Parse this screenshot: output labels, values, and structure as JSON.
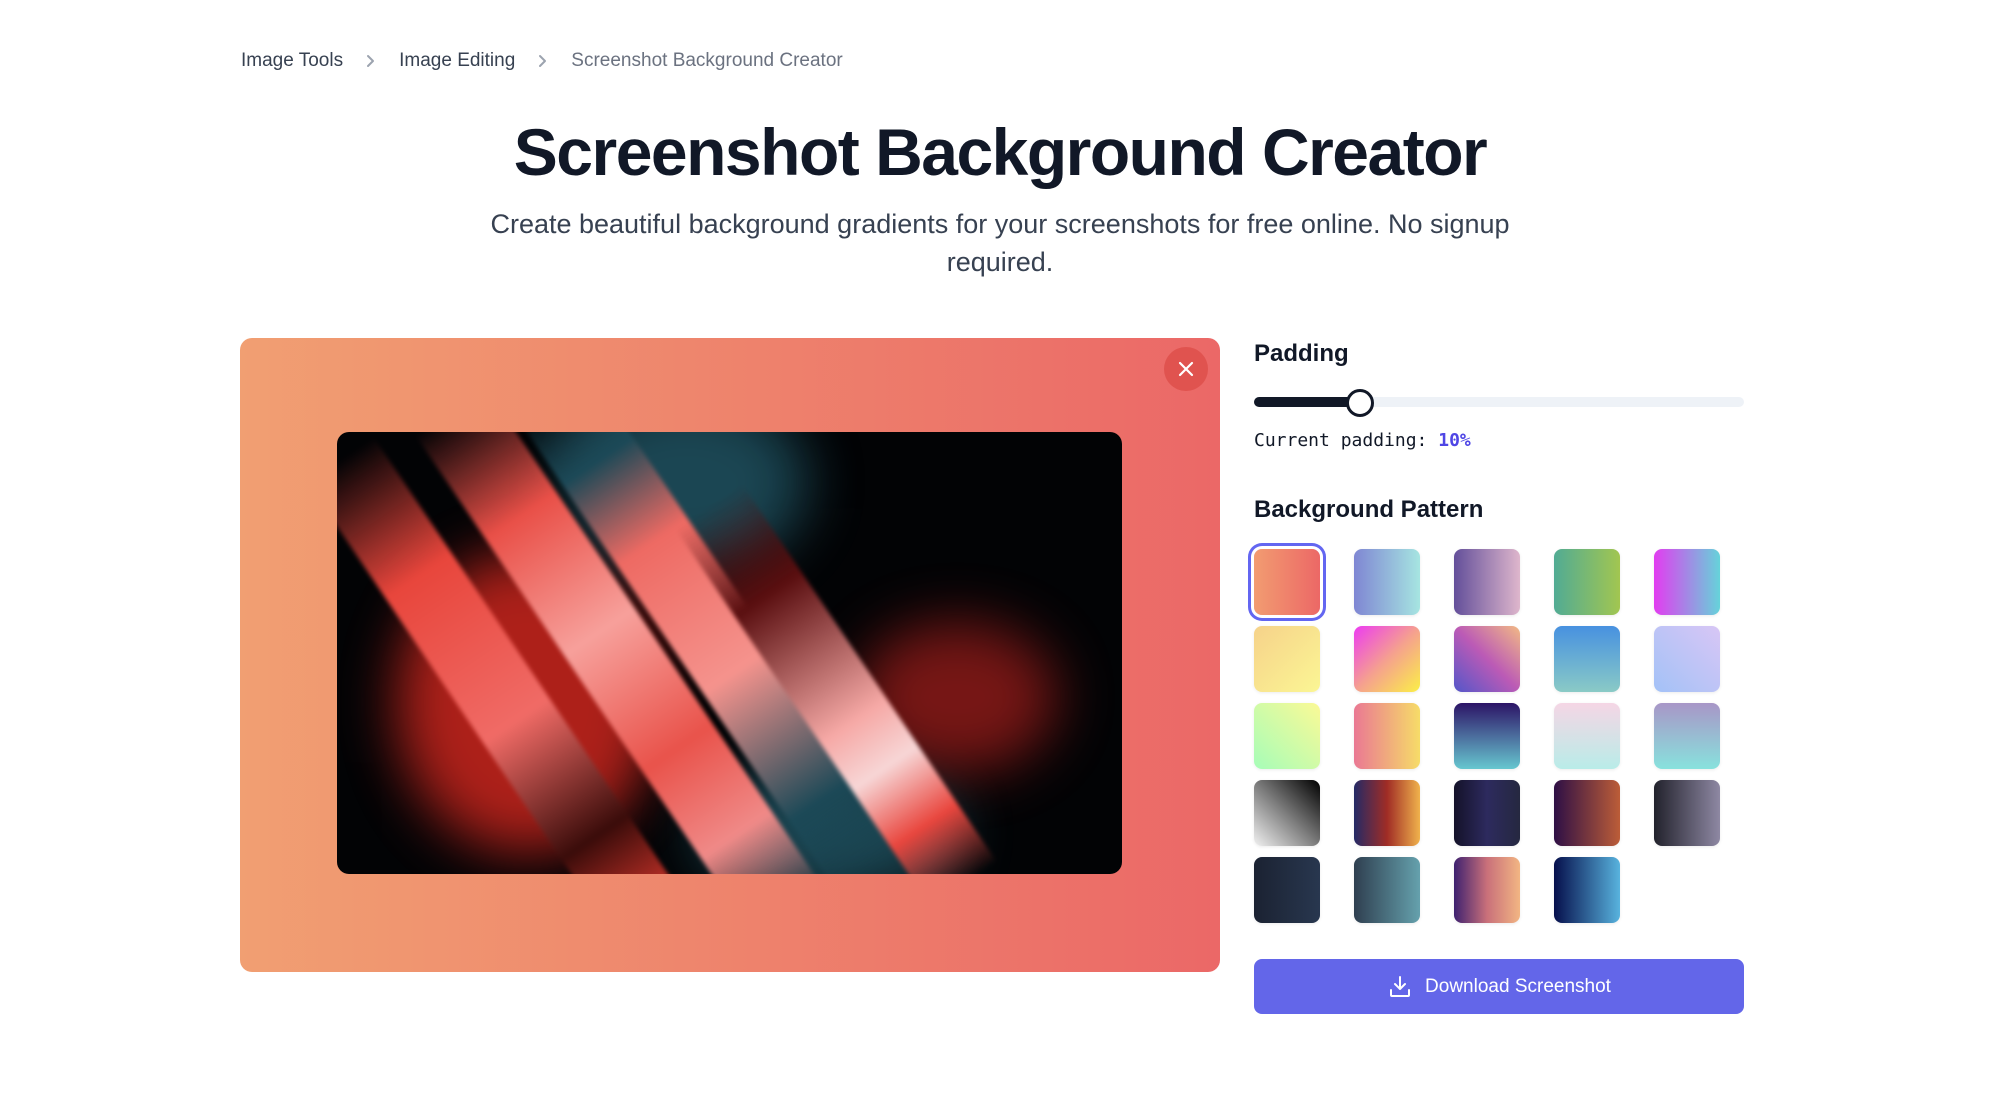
{
  "breadcrumb": {
    "items": [
      {
        "label": "Image Tools"
      },
      {
        "label": "Image Editing"
      },
      {
        "label": "Screenshot Background Creator"
      }
    ],
    "separator_icon": "chevron-right-icon"
  },
  "header": {
    "title": "Screenshot Background Creator",
    "subtitle": "Create beautiful background gradients for your screenshots for free online. No signup required."
  },
  "preview": {
    "background_gradient": [
      "#f19f72",
      "#eb6867"
    ],
    "close_icon": "close-icon",
    "image_description": "abstract red and teal diagonal streaks on black"
  },
  "controls": {
    "padding": {
      "label": "Padding",
      "readout_label": "Current padding:",
      "value": "10%",
      "slider_fraction": 0.2
    },
    "pattern": {
      "label": "Background Pattern",
      "selected_index": 0,
      "swatches": [
        {
          "dir": "to right",
          "colors": [
            "#f29c71",
            "#ec6866"
          ]
        },
        {
          "dir": "to right",
          "colors": [
            "#7f86d3",
            "#a6e5e1"
          ]
        },
        {
          "dir": "to right",
          "colors": [
            "#634f9a",
            "#deb6cc"
          ]
        },
        {
          "dir": "to right",
          "colors": [
            "#51ab94",
            "#a2c650"
          ]
        },
        {
          "dir": "to right",
          "colors": [
            "#e23cf0",
            "#65d3da"
          ]
        },
        {
          "dir": "135deg",
          "colors": [
            "#f6d28a",
            "#fbf694"
          ]
        },
        {
          "dir": "135deg",
          "colors": [
            "#ec3bf2",
            "#f5a08f",
            "#fbef47"
          ]
        },
        {
          "dir": "45deg",
          "colors": [
            "#5356c9",
            "#bb5ab6",
            "#f2b985"
          ]
        },
        {
          "dir": "to bottom",
          "colors": [
            "#4791e0",
            "#8acac6"
          ]
        },
        {
          "dir": "45deg",
          "colors": [
            "#a3c2f7",
            "#d8c6f5"
          ]
        },
        {
          "dir": "45deg",
          "colors": [
            "#a6fdb8",
            "#fbf996"
          ]
        },
        {
          "dir": "to right",
          "colors": [
            "#ea7893",
            "#f6dc68"
          ]
        },
        {
          "dir": "to bottom",
          "colors": [
            "#2c1466",
            "#4b6d9d",
            "#66c7cf"
          ]
        },
        {
          "dir": "to bottom",
          "colors": [
            "#f5d6e5",
            "#b9ece8"
          ]
        },
        {
          "dir": "to bottom",
          "colors": [
            "#a896c7",
            "#88e2dd"
          ]
        },
        {
          "dir": "45deg",
          "colors": [
            "#f1f1f1",
            "#7a7a7a",
            "#000000"
          ]
        },
        {
          "dir": "to right",
          "colors": [
            "#242a66",
            "#a02c25",
            "#f0b24c"
          ]
        },
        {
          "dir": "to right",
          "colors": [
            "#141229",
            "#2d2a5e",
            "#252840"
          ]
        },
        {
          "dir": "to right",
          "colors": [
            "#2e0f45",
            "#bc5d38"
          ]
        },
        {
          "dir": "to right",
          "colors": [
            "#22222c",
            "#8e88a3"
          ]
        },
        {
          "dir": "to right",
          "colors": [
            "#1b2232",
            "#28374f"
          ]
        },
        {
          "dir": "to right",
          "colors": [
            "#2f3f50",
            "#65a1ad"
          ]
        },
        {
          "dir": "to right",
          "colors": [
            "#3e2170",
            "#c9707a",
            "#f2b583"
          ]
        },
        {
          "dir": "to right",
          "colors": [
            "#060f4c",
            "#58b3de"
          ]
        }
      ]
    },
    "download": {
      "label": "Download Screenshot",
      "icon": "download-icon",
      "color": "#6366e9"
    }
  }
}
